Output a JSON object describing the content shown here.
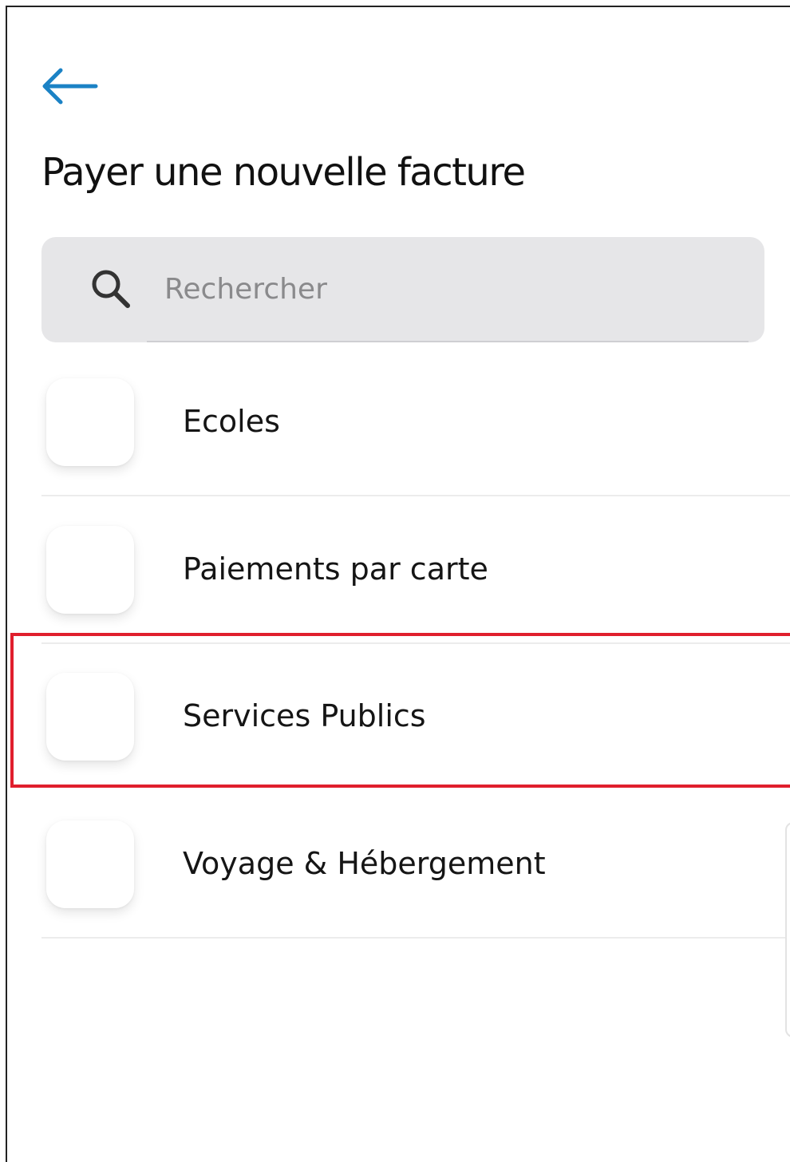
{
  "header": {
    "back_icon": "arrow-left-icon",
    "title": "Payer une nouvelle facture"
  },
  "search": {
    "placeholder": "Rechercher",
    "value": "",
    "icon": "search-icon"
  },
  "categories": [
    {
      "label": "Ecoles"
    },
    {
      "label": "Paiements par carte"
    },
    {
      "label": "Services Publics"
    },
    {
      "label": "Voyage & Hébergement"
    }
  ],
  "colors": {
    "accent": "#1b82c5",
    "highlight": "#e01f2d",
    "search_background": "#e6e6e8"
  }
}
